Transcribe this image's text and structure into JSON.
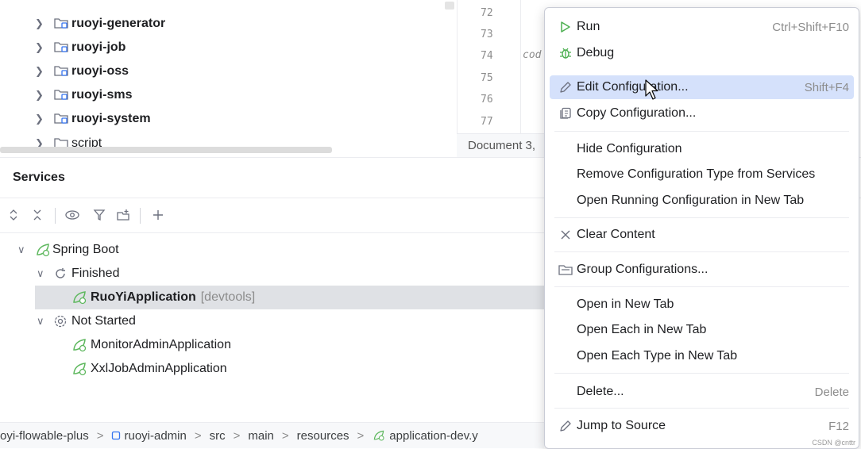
{
  "project_tree": {
    "items": [
      {
        "label": "ruoyi-generator",
        "bold": true
      },
      {
        "label": "ruoyi-job",
        "bold": true
      },
      {
        "label": "ruoyi-oss",
        "bold": true
      },
      {
        "label": "ruoyi-sms",
        "bold": true
      },
      {
        "label": "ruoyi-system",
        "bold": true
      },
      {
        "label": "script",
        "bold": false
      }
    ]
  },
  "editor": {
    "line_numbers": [
      "72",
      "73",
      "74",
      "75",
      "76",
      "77"
    ],
    "code_fragment": "cod",
    "status_text": "Document 3,"
  },
  "services": {
    "title": "Services",
    "tree": {
      "root": "Spring Boot",
      "finished_group": "Finished",
      "finished_app": "RuoYiApplication",
      "finished_app_tag": "[devtools]",
      "not_started_group": "Not Started",
      "not_started_apps": [
        "MonitorAdminApplication",
        "XxlJobAdminApplication"
      ]
    }
  },
  "breadcrumb": {
    "items": [
      "oyi-flowable-plus",
      "ruoyi-admin",
      "src",
      "main",
      "resources",
      "application-dev.y"
    ],
    "separator": ">"
  },
  "context_menu": {
    "items": {
      "run": {
        "label": "Run",
        "shortcut": "Ctrl+Shift+F10",
        "icon": "run-icon"
      },
      "debug": {
        "label": "Debug",
        "icon": "debug-icon"
      },
      "edit_config": {
        "label": "Edit Configuration...",
        "shortcut": "Shift+F4",
        "icon": "pencil-icon"
      },
      "copy_config": {
        "label": "Copy Configuration...",
        "icon": "copy-icon"
      },
      "hide_config": {
        "label": "Hide Configuration"
      },
      "remove_type": {
        "label": "Remove Configuration Type from Services"
      },
      "open_running": {
        "label": "Open Running Configuration in New Tab"
      },
      "clear_content": {
        "label": "Clear Content",
        "icon": "close-icon"
      },
      "group_configs": {
        "label": "Group Configurations...",
        "icon": "group-icon"
      },
      "open_new_tab": {
        "label": "Open in New Tab"
      },
      "open_each": {
        "label": "Open Each in New Tab"
      },
      "open_each_type": {
        "label": "Open Each Type in New Tab"
      },
      "delete": {
        "label": "Delete...",
        "shortcut": "Delete"
      },
      "jump_source": {
        "label": "Jump to Source",
        "shortcut": "F12",
        "icon": "pencil-icon"
      }
    },
    "watermark": "CSDN @cnttr"
  },
  "colors": {
    "accent_highlight": "#d5e1fb",
    "selection": "#dfe1e5",
    "spring_green": "#5fb85f",
    "run_green": "#4caf50",
    "module_blue": "#3574f0"
  }
}
